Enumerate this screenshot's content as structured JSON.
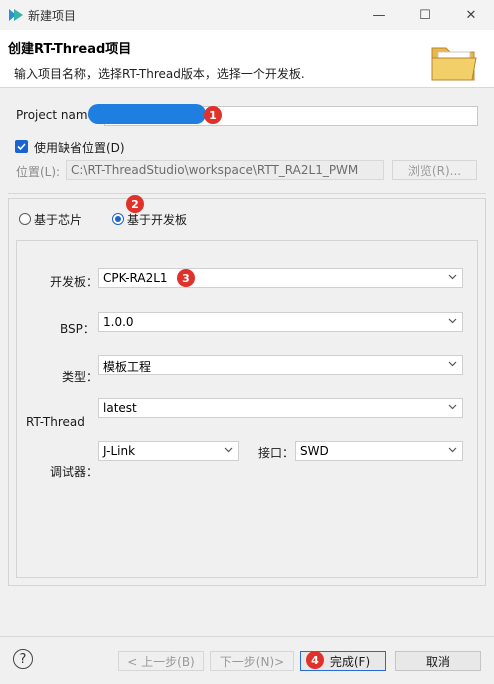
{
  "window": {
    "title": "新建项目",
    "controls": {
      "minimize": "—",
      "maximize": "☐",
      "close": "✕"
    }
  },
  "banner": {
    "heading": "创建RT-Thread项目",
    "subtitle": "输入项目名称，选择RT-Thread版本，选择一个开发板."
  },
  "project": {
    "name_label": "Project name",
    "name_value": ""
  },
  "location": {
    "use_default_label": "使用缺省位置(D)",
    "use_default_checked": true,
    "label": "位置(L):",
    "path": "C:\\RT-ThreadStudio\\workspace\\RTT_RA2L1_PWM",
    "browse_label": "浏览(R)..."
  },
  "base_option": {
    "chip_label": "基于芯片",
    "board_label": "基于开发板",
    "selected": "board"
  },
  "board_group": {
    "board_label": "开发板：",
    "board_value": "CPK-RA2L1",
    "bsp_label": "BSP：",
    "bsp_value": "1.0.0",
    "type_label": "类型：",
    "type_value": "模板工程",
    "rtthread_label": "RT-Thread",
    "rtthread_value": "latest",
    "debugger_label": "调试器：",
    "debugger_value": "J-Link",
    "interface_label": "接口：",
    "interface_value": "SWD"
  },
  "footer": {
    "help_symbol": "?",
    "back_label": "< 上一步(B)",
    "next_label": "下一步(N)>",
    "finish_label": "完成(F)",
    "cancel_label": "取消"
  },
  "annotations": {
    "n1": "1",
    "n2": "2",
    "n3": "3",
    "n4": "4",
    "color": "#e0322a"
  }
}
